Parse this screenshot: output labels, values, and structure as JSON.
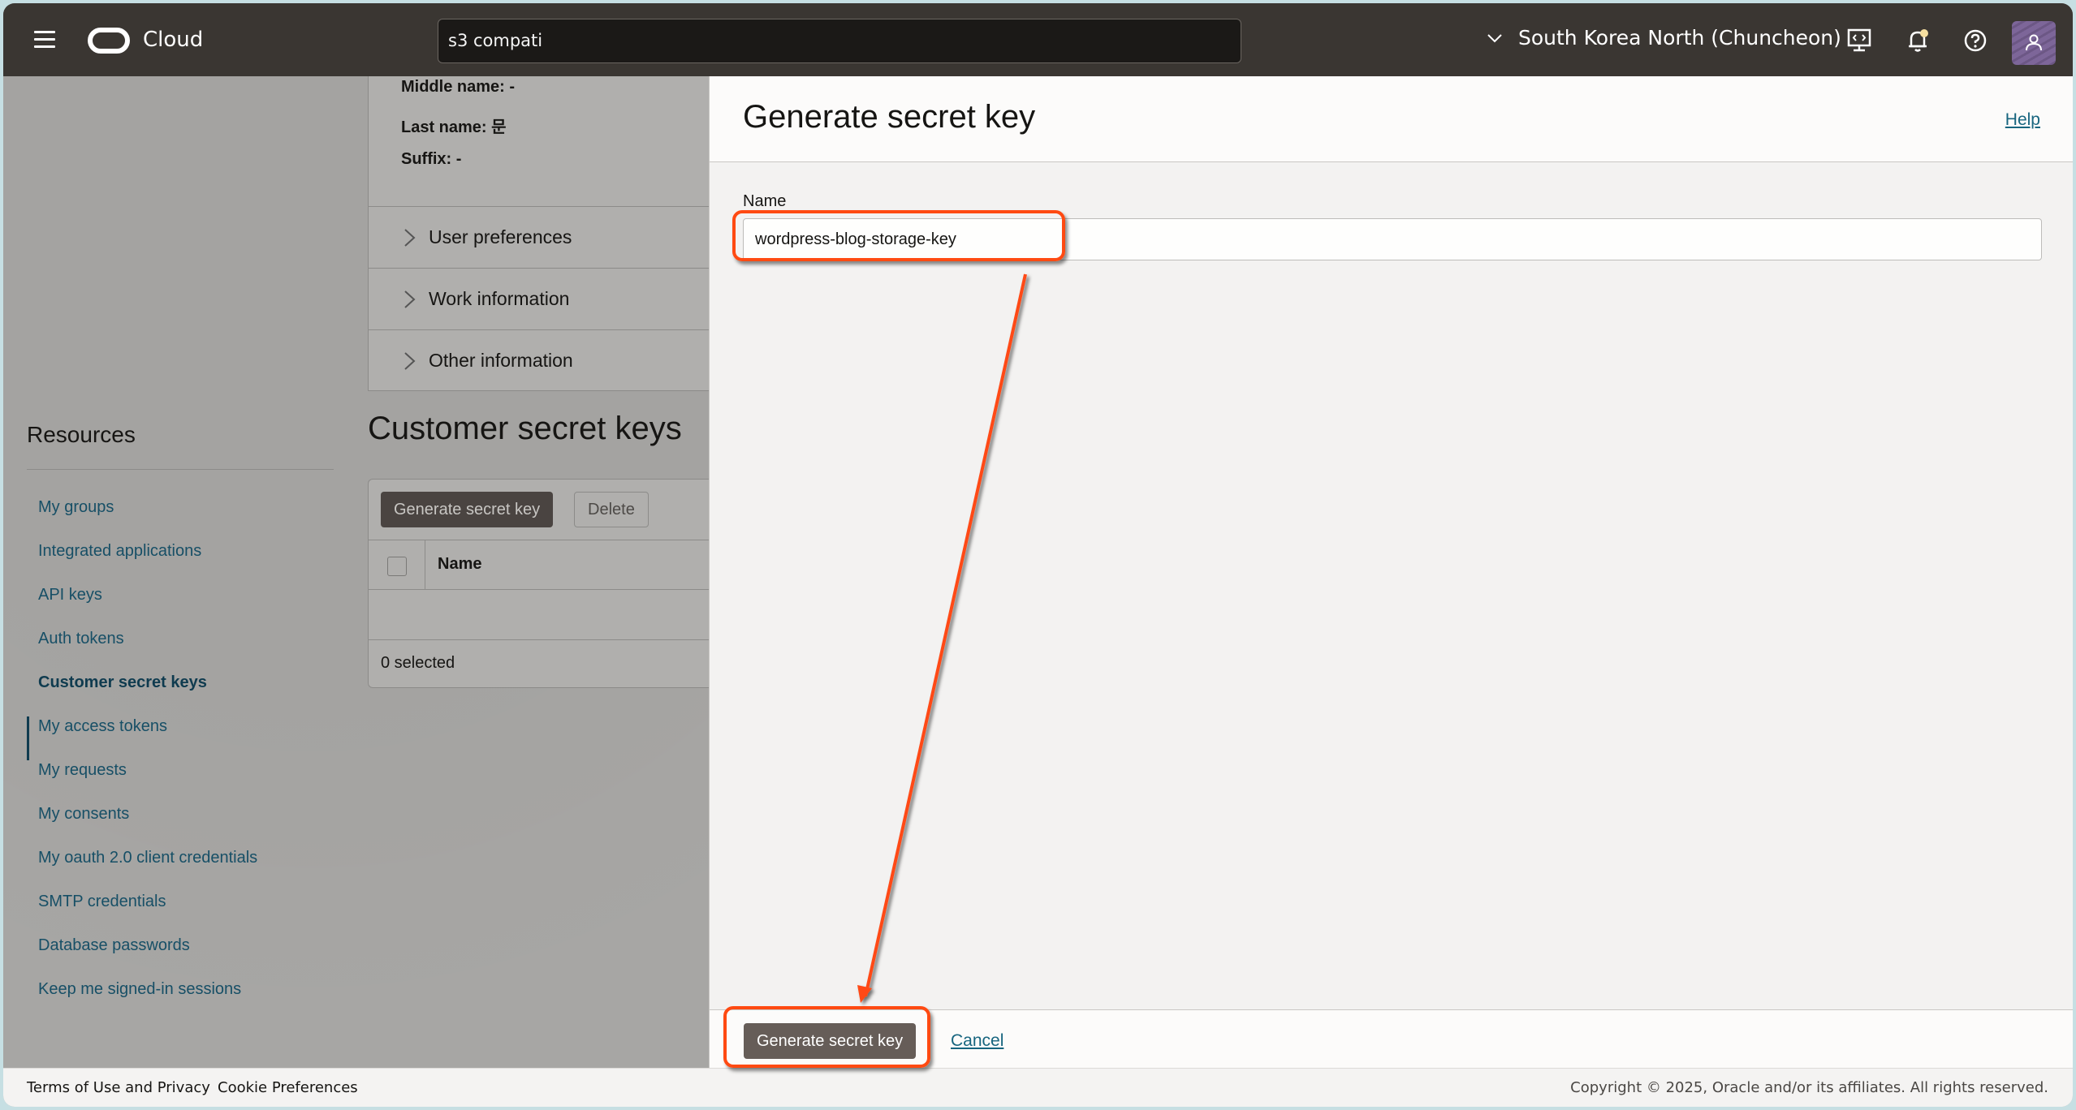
{
  "topbar": {
    "brand": "Cloud",
    "search_value": "s3 compati",
    "region": "South Korea North (Chuncheon)",
    "icons": [
      "developer-tools-icon",
      "notifications-icon",
      "help-icon",
      "user-avatar-icon"
    ]
  },
  "detail": {
    "middle_name": "Middle name: -",
    "last_name": "Last name: 문",
    "suffix": "Suffix: -",
    "accordion": [
      {
        "label": "User preferences"
      },
      {
        "label": "Work information"
      },
      {
        "label": "Other information"
      }
    ]
  },
  "resources": {
    "title": "Resources",
    "items": [
      {
        "label": "My groups"
      },
      {
        "label": "Integrated applications"
      },
      {
        "label": "API keys"
      },
      {
        "label": "Auth tokens"
      },
      {
        "label": "Customer secret keys",
        "active": true
      },
      {
        "label": "My access tokens"
      },
      {
        "label": "My requests"
      },
      {
        "label": "My consents"
      },
      {
        "label": "My oauth 2.0 client credentials"
      },
      {
        "label": "SMTP credentials"
      },
      {
        "label": "Database passwords"
      },
      {
        "label": "Keep me signed-in sessions"
      }
    ]
  },
  "secret_keys": {
    "title": "Customer secret keys",
    "generate_label": "Generate secret key",
    "delete_label": "Delete",
    "column_name": "Name",
    "selected_count": "0 selected"
  },
  "drawer": {
    "title": "Generate secret key",
    "help_label": "Help",
    "name_label": "Name",
    "name_value": "wordpress-blog-storage-key",
    "submit_label": "Generate secret key",
    "cancel_label": "Cancel"
  },
  "footer": {
    "terms": "Terms of Use and Privacy",
    "cookies": "Cookie Preferences",
    "copyright": "Copyright © 2025, Oracle and/or its affiliates. All rights reserved."
  },
  "colors": {
    "header_bg": "#3a3632",
    "link": "#17657f",
    "annotation": "#ff4a12",
    "primary_button": "#665d58"
  }
}
